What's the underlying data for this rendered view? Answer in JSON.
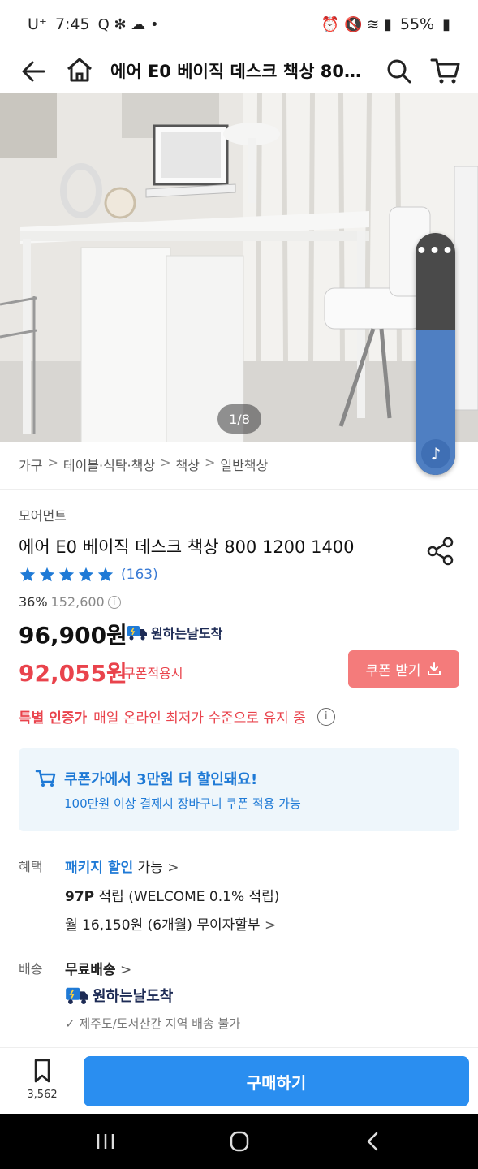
{
  "status_bar": {
    "carrier": "U⁺",
    "time": "7:45",
    "battery": "55%"
  },
  "header": {
    "title": "에어 E0 베이직 데스크 책상 800..."
  },
  "hero": {
    "pager": "1/8"
  },
  "breadcrumb": [
    "가구",
    "테이블·식탁·책상",
    "책상",
    "일반책상"
  ],
  "product": {
    "brand": "모어먼트",
    "title": "에어 E0 베이직 데스크 책상 800 1200 1400",
    "rating_stars": 5,
    "review_count": "(163)",
    "discount_rate": "36%",
    "original_price": "152,600",
    "price": "96,900원",
    "delivery_badge": "원하는날도착",
    "coupon_price": "92,055원",
    "coupon_label": "쿠폰적용시",
    "coupon_button": "쿠폰 받기"
  },
  "special": {
    "label": "특별 인증가",
    "text": "매일 온라인 최저가 수준으로 유지 중"
  },
  "banner": {
    "title": "쿠폰가에서 3만원 더 할인돼요!",
    "subtitle": "100만원 이상 결제시 장바구니 쿠폰 적용 가능"
  },
  "benefits": {
    "label": "혜택",
    "package": "패키지 할인",
    "package_suffix": "가능",
    "points_bold": "97P",
    "points_text": "적립 (WELCOME 0.1% 적립)",
    "installment": "월 16,150원 (6개월) 무이자할부"
  },
  "shipping": {
    "label": "배송",
    "free": "무료배송",
    "badge": "원하는날도착",
    "note": "제주도/도서산간 지역 배송 불가"
  },
  "bottom": {
    "bookmark_count": "3,562",
    "buy_label": "구매하기"
  },
  "colors": {
    "accent_blue": "#2a8ef0",
    "sale_red": "#e9434c",
    "coupon_button": "#f47b7b",
    "star": "#1f7ad6"
  }
}
